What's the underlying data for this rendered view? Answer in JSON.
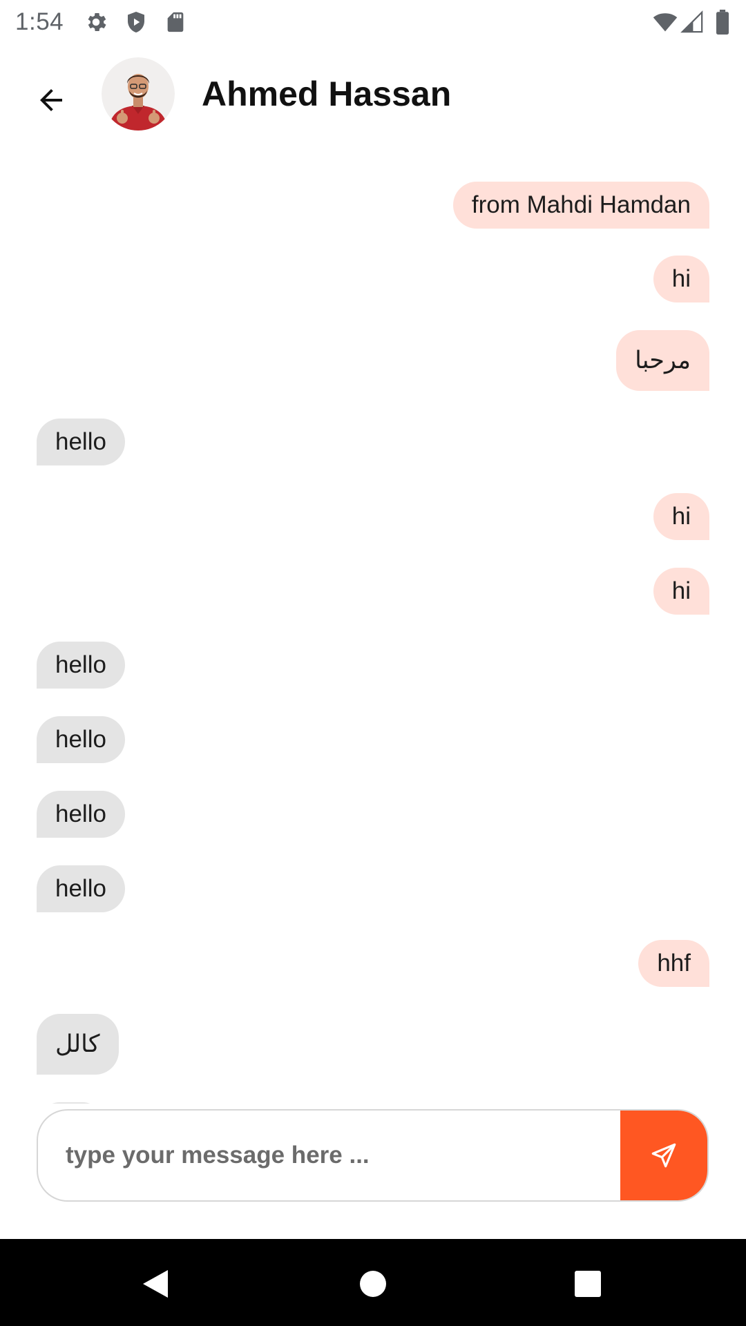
{
  "status_bar": {
    "time": "1:54",
    "icons_left": [
      "settings-icon",
      "shield-icon",
      "sd-card-icon"
    ],
    "icons_right": [
      "wifi-icon",
      "cellular-icon",
      "battery-icon"
    ]
  },
  "header": {
    "contact_name": "Ahmed Hassan",
    "back_icon": "arrow-back-icon",
    "avatar": "contact-avatar"
  },
  "messages": [
    {
      "side": "sent",
      "text": "from Mahdi Hamdan"
    },
    {
      "side": "sent",
      "text": "hi"
    },
    {
      "side": "sent",
      "text": "مرحبا"
    },
    {
      "side": "received",
      "text": "hello"
    },
    {
      "side": "sent",
      "text": "hi"
    },
    {
      "side": "sent",
      "text": "hi"
    },
    {
      "side": "received",
      "text": "hello"
    },
    {
      "side": "received",
      "text": "hello"
    },
    {
      "side": "received",
      "text": "hello"
    },
    {
      "side": "received",
      "text": "hello"
    },
    {
      "side": "sent",
      "text": "hhf"
    },
    {
      "side": "received",
      "text": "كالل"
    }
  ],
  "composer": {
    "placeholder": "type your message here ...",
    "value": "",
    "send_icon": "send-icon"
  },
  "nav_bar": {
    "buttons": [
      "back-nav-icon",
      "home-nav-icon",
      "recents-nav-icon"
    ]
  },
  "colors": {
    "accent": "#ff5722",
    "sent_bubble": "#ffe0d9",
    "received_bubble": "#e4e4e4"
  }
}
